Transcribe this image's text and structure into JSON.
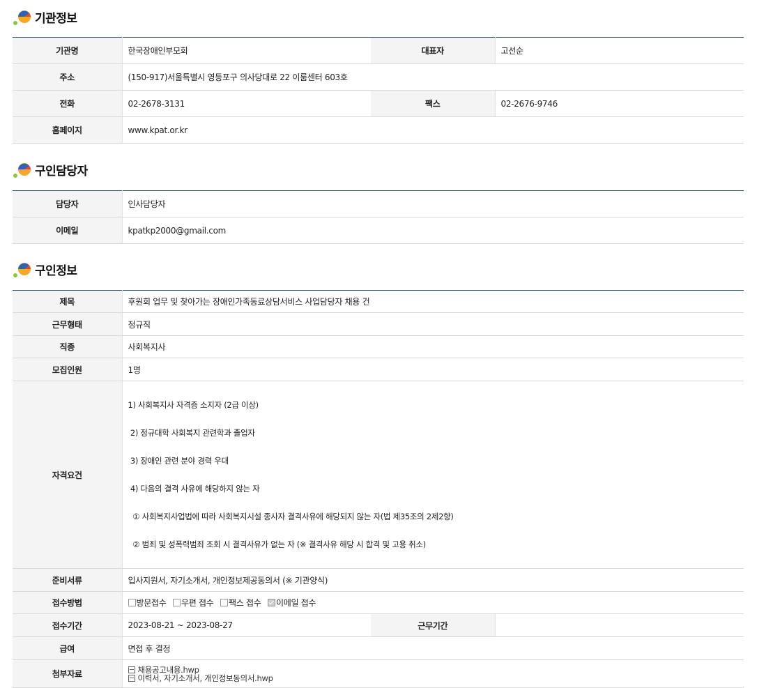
{
  "agency": {
    "title": "기관정보",
    "name_label": "기관명",
    "name": "한국장애인부모회",
    "ceo_label": "대표자",
    "ceo": "고선순",
    "address_label": "주소",
    "address": "(150-917)서울특별시 영등포구 의사당대로 22 이룸센터 603호",
    "phone_label": "전화",
    "phone": "02-2678-3131",
    "fax_label": "팩스",
    "fax": "02-2676-9746",
    "homepage_label": "홈페이지",
    "homepage": "www.kpat.or.kr"
  },
  "contact": {
    "title": "구인담당자",
    "person_label": "담당자",
    "person": "인사담당자",
    "email_label": "이메일",
    "email": "kpatkp2000@gmail.com"
  },
  "job": {
    "title": "구인정보",
    "subject_label": "제목",
    "subject": "후원회 업무 및 찾아가는 장애인가족동료상담서비스 사업담당자 채용 건",
    "type_label": "근무형태",
    "type": "정규직",
    "position_label": "직종",
    "position": "사회복지사",
    "count_label": "모집인원",
    "count": "1명",
    "qual_label": "자격요건",
    "qualifications": [
      "1) 사회복지사 자격증 소지자 (2급 이상)",
      " 2) 정규대학 사회복지 관련학과 졸업자",
      " 3) 장애인 관련 분야 경력 우대",
      " 4) 다음의 결격 사유에 해당하지 않는 자",
      "  ① 사회복지사업법에 따라 사회복지시설 종사자 결격사유에 해당되지 않는 자(법 제35조의 2제2항)",
      "  ② 범죄 및 성폭력범죄 조회 시 결격사유가 없는 자 (※ 결격사유 해당 시 합격 및 고용 취소)"
    ],
    "docs_label": "준비서류",
    "docs": "입사지원서, 자기소개서, 개인정보제공동의서 (※ 기관양식)",
    "method_label": "접수방법",
    "methods": [
      {
        "label": "방문접수",
        "checked": false
      },
      {
        "label": "우편 접수",
        "checked": false
      },
      {
        "label": "팩스 접수",
        "checked": false
      },
      {
        "label": "이메일 접수",
        "checked": true
      }
    ],
    "period_label": "접수기간",
    "period": "2023-08-21 ~ 2023-08-27",
    "work_period_label": "근무기간",
    "work_period": "",
    "salary_label": "급여",
    "salary": "면접 후 결정",
    "attach_label": "첨부자료",
    "attachments": [
      "채용공고내용.hwp",
      "이력서, 자기소개서, 개인정보동의서.hwp"
    ]
  },
  "colors": {
    "header_line": "#2d4f6b",
    "th_bg": "#f4f4f4"
  }
}
